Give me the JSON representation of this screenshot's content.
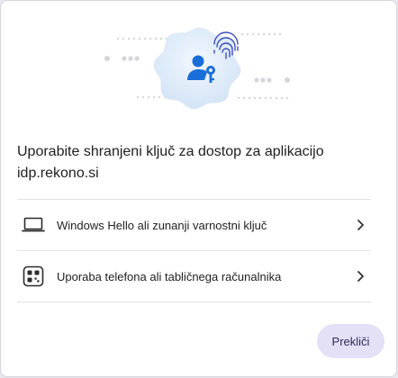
{
  "dialog": {
    "title": "Uporabite shranjeni ključ za dostop za aplikacijo idp.rekono.si",
    "options": [
      {
        "label": "Windows Hello ali zunanji varnostni ključ",
        "icon": "laptop-icon"
      },
      {
        "label": "Uporaba telefona ali tabličnega računalnika",
        "icon": "qr-code-icon"
      }
    ],
    "cancel_label": "Prekliči"
  },
  "colors": {
    "accent": "#1a6ed8",
    "badge_light": "#dceaf8",
    "cancel_bg": "#e4e1f7"
  }
}
